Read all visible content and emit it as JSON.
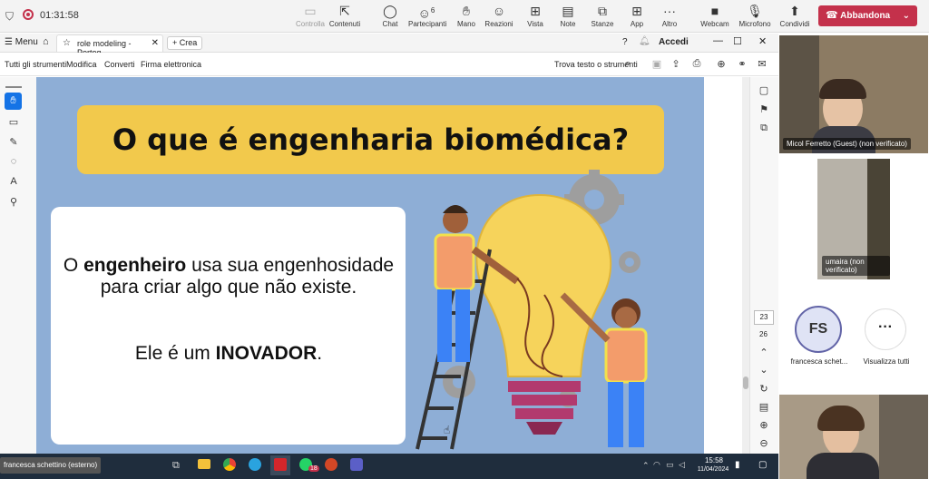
{
  "meeting": {
    "timer": "01:31:58",
    "buttons": [
      {
        "label": "Controlla",
        "icon": "screen-icon",
        "dim": true
      },
      {
        "label": "Contenuti",
        "icon": "share-content-icon",
        "dim": false
      },
      {
        "label": "Chat",
        "icon": "chat-icon",
        "dim": false
      },
      {
        "label": "Partecipanti",
        "icon": "people-icon",
        "dim": false,
        "badge": "6"
      },
      {
        "label": "Mano",
        "icon": "hand-icon",
        "dim": false
      },
      {
        "label": "Reazioni",
        "icon": "smile-icon",
        "dim": false
      },
      {
        "label": "Vista",
        "icon": "grid-icon",
        "dim": false
      },
      {
        "label": "Note",
        "icon": "notes-icon",
        "dim": false
      },
      {
        "label": "Stanze",
        "icon": "rooms-icon",
        "dim": false
      },
      {
        "label": "App",
        "icon": "plus-icon",
        "dim": false
      },
      {
        "label": "Altro",
        "icon": "more-icon",
        "dim": false
      },
      {
        "label": "Webcam",
        "icon": "camera-icon",
        "dim": false
      },
      {
        "label": "Microfono",
        "icon": "mic-off-icon",
        "dim": false
      },
      {
        "label": "Condividi",
        "icon": "share-icon",
        "dim": false
      }
    ],
    "leave_label": "Abbandona"
  },
  "acrobat": {
    "menu_label": "Menu",
    "tab_title": "role modeling - Portog...",
    "new_label": "Crea",
    "signin": "Accedi",
    "tools": [
      "Tutti gli strumenti",
      "Modifica",
      "Converti",
      "Firma elettronica"
    ],
    "search_label": "Trova testo o strumenti",
    "page_current": "23",
    "page_total": "26"
  },
  "slide": {
    "title": "O que é engenharia biomédica?",
    "p1_pre": "O ",
    "p1_bold": "engenheiro",
    "p1_post": " usa sua engenhosidade para criar algo que não existe.",
    "p2_pre": "Ele é um ",
    "p2_bold": "INOVADOR",
    "p2_post": "."
  },
  "participants": [
    {
      "name": "Micol Ferretto (Guest) (non verificato)"
    },
    {
      "name": "umaira (non verificato)"
    },
    {
      "name": "francesca schet...",
      "initials": "FS"
    },
    {
      "name": "Visualizza tutti"
    },
    {
      "name": "francesca schettino (esterno)"
    }
  ],
  "taskbar": {
    "time": "15:58",
    "date": "11/04/2024",
    "whatsapp_badge": "18"
  }
}
